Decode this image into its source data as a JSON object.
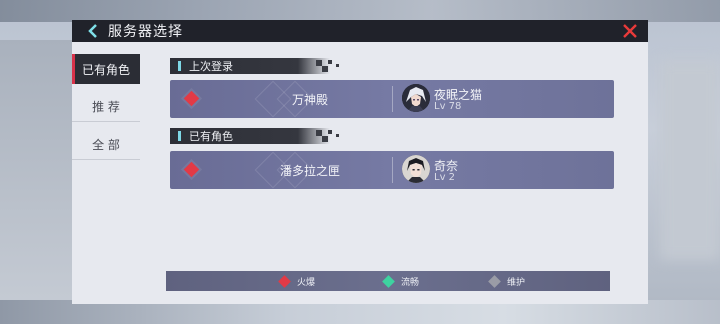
{
  "header": {
    "title": "服务器选择",
    "back_icon": "chevron-left-icon",
    "close_icon": "close-x-icon"
  },
  "sidebar": {
    "tabs": [
      {
        "label": "已有角色",
        "active": true
      },
      {
        "label": "推 荐",
        "active": false
      },
      {
        "label": "全 部",
        "active": false
      }
    ]
  },
  "sections": [
    {
      "header": "上次登录",
      "server": {
        "status": "hot",
        "status_color": "#e23a46",
        "name": "万神殿",
        "character": {
          "name": "夜眠之猫",
          "level": "Lv 78",
          "avatar": "white-hair-avatar"
        }
      }
    },
    {
      "header": "已有角色",
      "server": {
        "status": "hot",
        "status_color": "#e23a46",
        "name": "潘多拉之匣",
        "character": {
          "name": "奇奈",
          "level": "Lv 2",
          "avatar": "dark-hair-avatar"
        }
      }
    }
  ],
  "legend": [
    {
      "label": "火爆",
      "color": "#e23a46"
    },
    {
      "label": "流畅",
      "color": "#3ed3a0"
    },
    {
      "label": "维护",
      "color": "#9a9ca6"
    }
  ],
  "colors": {
    "accent_red": "#d8324a",
    "accent_cyan": "#7fd8e6",
    "card": "#6e7299"
  }
}
